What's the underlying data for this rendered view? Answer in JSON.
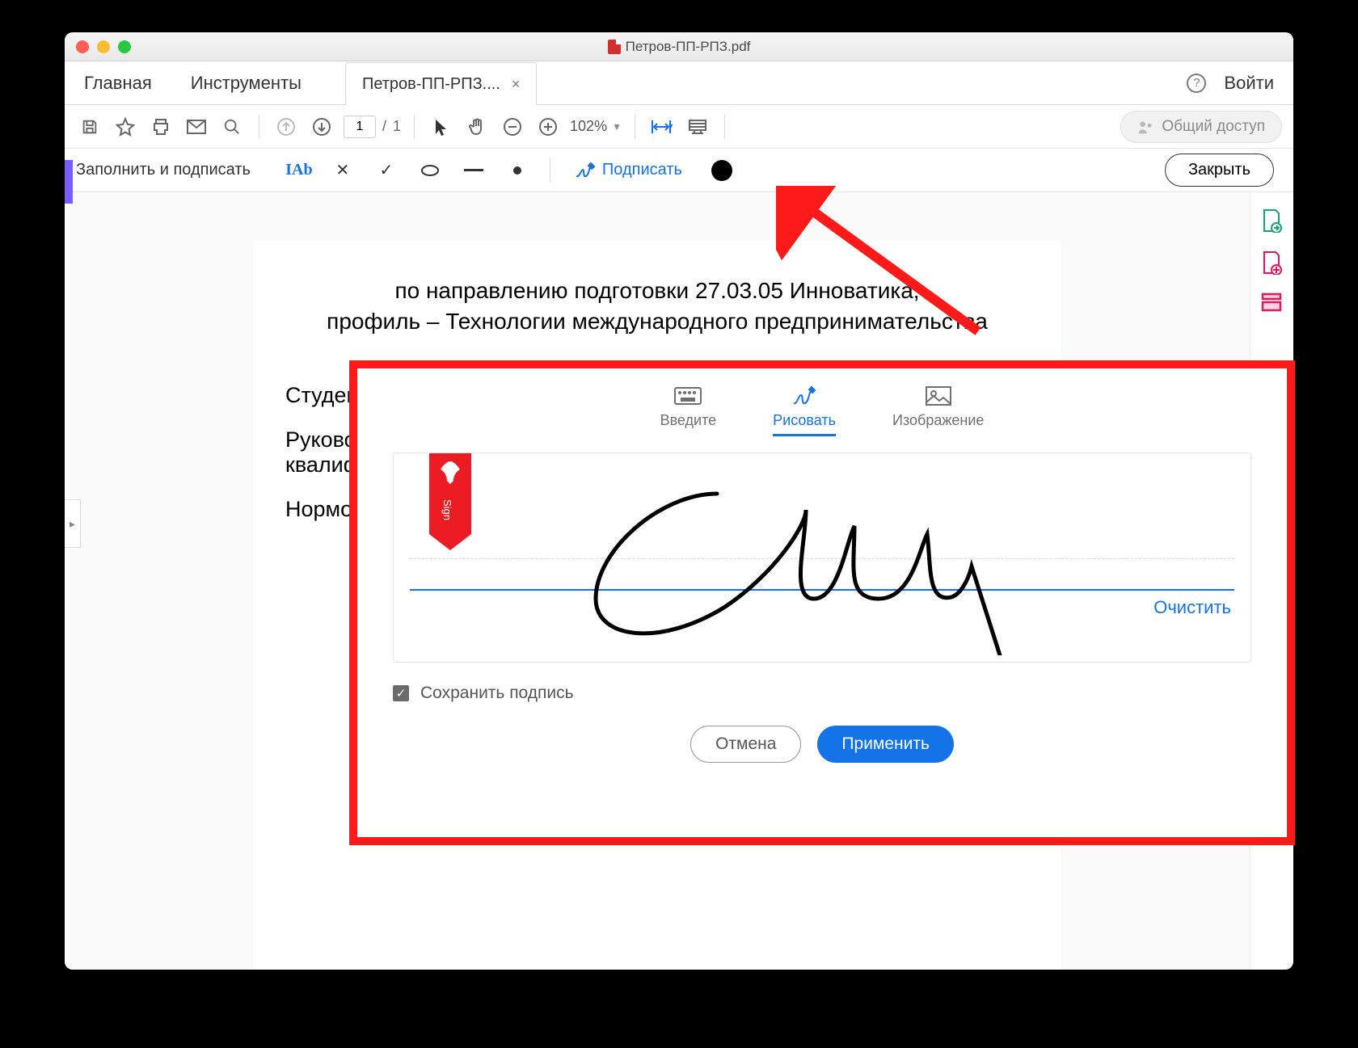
{
  "window": {
    "title": "Петров-ПП-РПЗ.pdf"
  },
  "tabs": {
    "home": "Главная",
    "tools": "Инструменты",
    "doc": "Петров-ПП-РПЗ....",
    "login": "Войти"
  },
  "toolbar": {
    "page_current": "1",
    "page_sep": "/",
    "page_total": "1",
    "zoom": "102%",
    "share": "Общий доступ"
  },
  "fillbar": {
    "title": "Заполнить и подписать",
    "ab": "IAb",
    "sign": "Подписать",
    "close": "Закрыть"
  },
  "document": {
    "line1": "по направлению подготовки 27.03.05 Инноватика,",
    "line2": "профиль – Технологии международного предпринимательства",
    "r1": "Студент п",
    "r2a": "Руководи",
    "r2b": "квалифик",
    "r3": "Нормокон"
  },
  "modal": {
    "tabs": {
      "type": "Введите",
      "draw": "Рисовать",
      "image": "Изображение"
    },
    "clear": "Очистить",
    "save": "Сохранить подпись",
    "cancel": "Отмена",
    "apply": "Применить",
    "bookmark": "Sign"
  }
}
